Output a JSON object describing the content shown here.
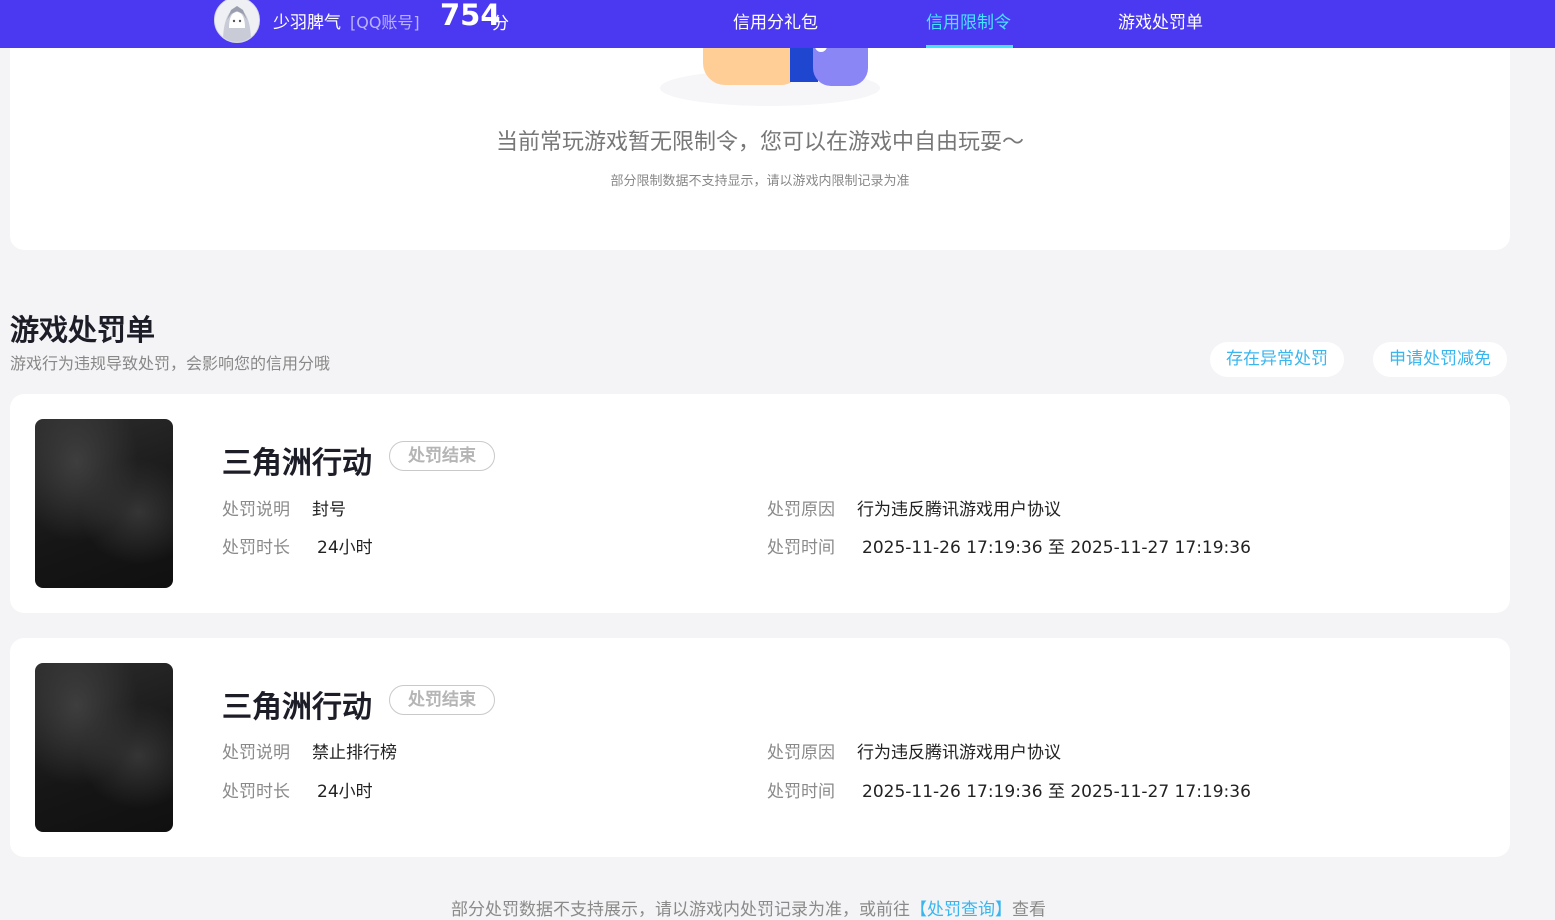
{
  "header": {
    "user_name": "少羽脾气",
    "account_type": "[QQ账号]",
    "score": "754",
    "score_unit": "分",
    "tabs": [
      {
        "label": "信用分礼包",
        "active": false
      },
      {
        "label": "信用限制令",
        "active": true
      },
      {
        "label": "游戏处罚单",
        "active": false
      }
    ],
    "colors": {
      "bar": "#4b39f2",
      "active_tab": "#46e3ff"
    }
  },
  "restriction": {
    "title": "当前常玩游戏暂无限制令，您可以在游戏中自由玩耍～",
    "note": "部分限制数据不支持显示，请以游戏内限制记录为准"
  },
  "penalty_section": {
    "title": "游戏处罚单",
    "subtitle": "游戏行为违规导致处罚，会影响您的信用分哦",
    "buttons": {
      "abnormal": "存在异常处罚",
      "reduction": "申请处罚减免"
    }
  },
  "penalties": [
    {
      "game": "三角洲行动",
      "status": "处罚结束",
      "desc_label": "处罚说明",
      "desc": "封号",
      "duration_label": "处罚时长",
      "duration": "24小时",
      "reason_label": "处罚原因",
      "reason": "行为违反腾讯游戏用户协议",
      "time_label": "处罚时间",
      "time": "2025-11-26 17:19:36 至 2025-11-27 17:19:36"
    },
    {
      "game": "三角洲行动",
      "status": "处罚结束",
      "desc_label": "处罚说明",
      "desc": "禁止排行榜",
      "duration_label": "处罚时长",
      "duration": "24小时",
      "reason_label": "处罚原因",
      "reason": "行为违反腾讯游戏用户协议",
      "time_label": "处罚时间",
      "time": "2025-11-26 17:19:36 至 2025-11-27 17:19:36"
    }
  ],
  "footer": {
    "text_before": "部分处罚数据不支持展示，请以游戏内处罚记录为准，或前往",
    "link": "【处罚查询】",
    "text_after": "查看"
  }
}
